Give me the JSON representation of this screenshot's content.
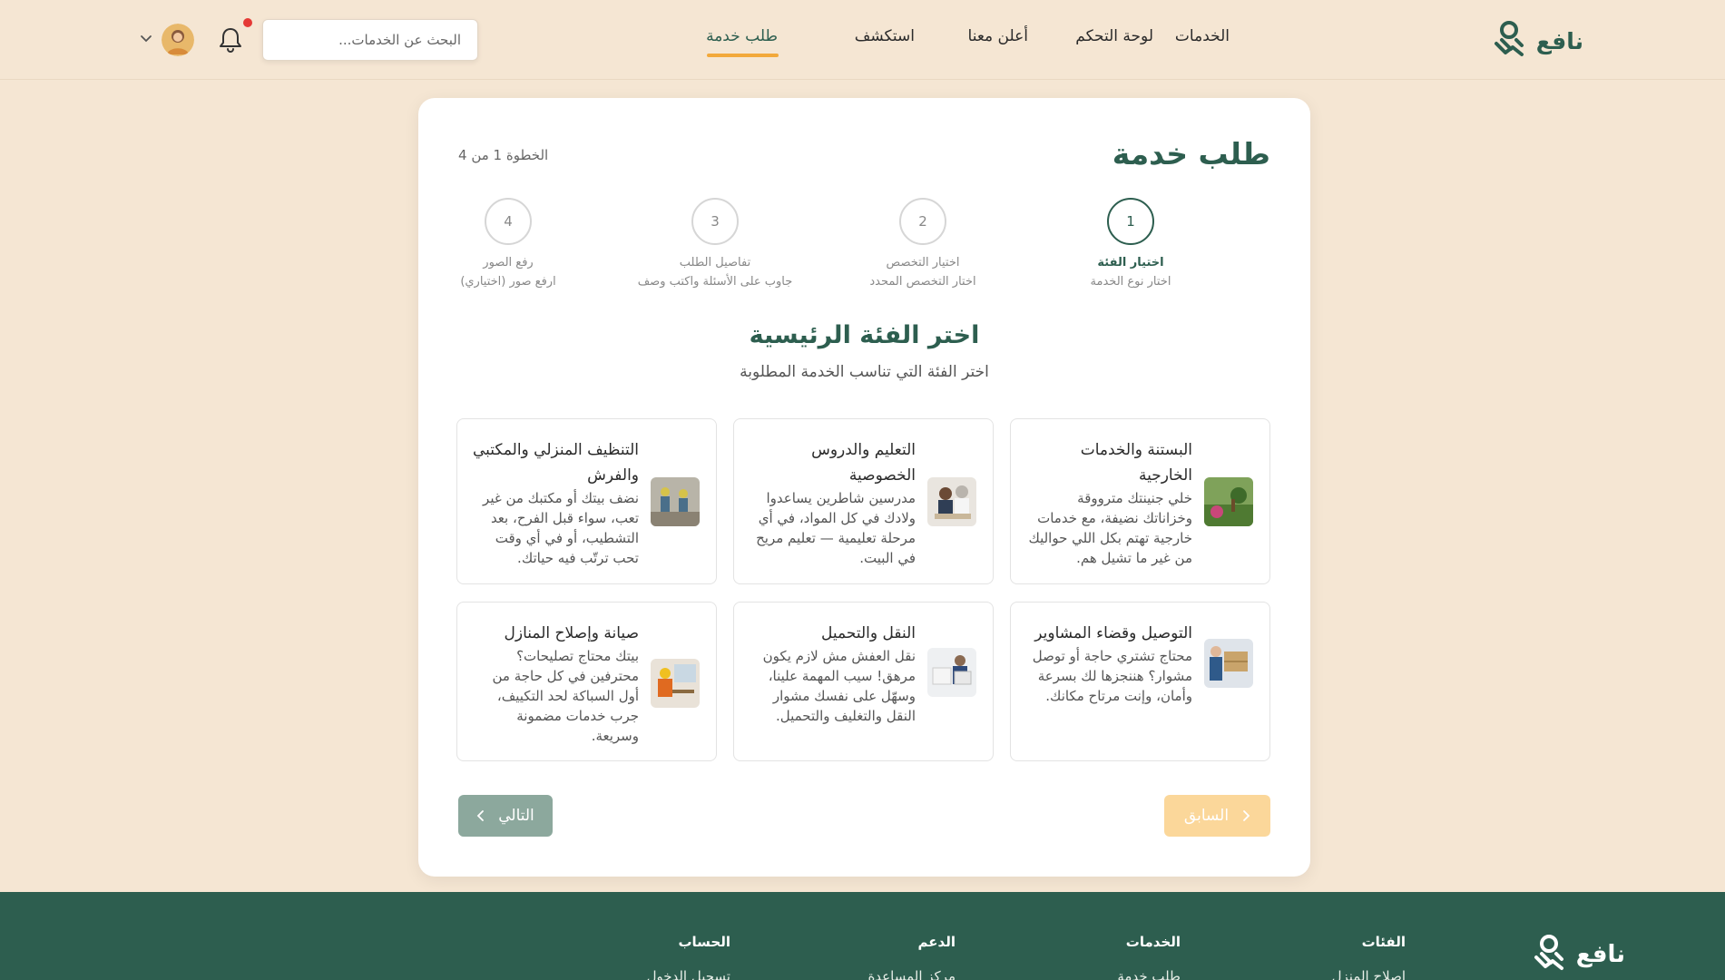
{
  "brand": {
    "name": "نافع",
    "color": "#2d5e4f",
    "accent": "#f2a93b"
  },
  "nav": [
    {
      "label": "الخدمات",
      "active": false
    },
    {
      "label": "لوحة التحكم",
      "active": false
    },
    {
      "label": "أعلن معنا",
      "active": false
    },
    {
      "label": "استكشف",
      "active": false
    },
    {
      "label": "طلب خدمة",
      "active": true
    }
  ],
  "search": {
    "placeholder": "البحث عن الخدمات..."
  },
  "page": {
    "title": "طلب خدمة",
    "step_counter": "الخطوة 1 من 4"
  },
  "steps": [
    {
      "number": "1",
      "title": "اختيار الفئة",
      "subtitle": "اختار نوع الخدمة",
      "active": true
    },
    {
      "number": "2",
      "title": "اختيار التخصص",
      "subtitle": "اختار التخصص المحدد",
      "active": false
    },
    {
      "number": "3",
      "title": "تفاصيل الطلب",
      "subtitle": "جاوب على الأسئلة واكتب وصف",
      "active": false
    },
    {
      "number": "4",
      "title": "رفع الصور",
      "subtitle": "ارفع صور (اختياري)",
      "active": false
    }
  ],
  "section": {
    "title": "اختر الفئة الرئيسية",
    "subtitle": "اختر الفئة التي تناسب الخدمة المطلوبة"
  },
  "categories": [
    {
      "title": "البستنة والخدمات الخارجية",
      "description": "خلي جنينتك مترووقة وخزاناتك نضيفة، مع خدمات خارجية تهتم بكل اللي حواليك من غير ما تشيل هم.",
      "icon": "garden-photo"
    },
    {
      "title": "التعليم والدروس الخصوصية",
      "description": "مدرسين شاطرين يساعدوا ولادك في كل المواد، في أي مرحلة تعليمية — تعليم مريح في البيت.",
      "icon": "tutoring-photo"
    },
    {
      "title": "التنظيف المنزلي والمكتبي والفرش",
      "description": "نضف بيتك أو مكتبك من غير تعب، سواء قبل الفرح، بعد التشطيب، أو في أي وقت تحب ترتّب فيه حياتك.",
      "icon": "cleaning-photo"
    },
    {
      "title": "التوصيل وقضاء المشاوير",
      "description": "محتاج تشتري حاجة أو توصل مشوار؟ هننجزها لك بسرعة وأمان، وإنت مرتاح مكانك.",
      "icon": "delivery-photo"
    },
    {
      "title": "النقل والتحميل",
      "description": "نقل العفش مش لازم يكون مرهق! سيب المهمة علينا، وسهّل على نفسك مشوار النقل والتغليف والتحميل.",
      "icon": "moving-photo"
    },
    {
      "title": "صيانة وإصلاح المنازل",
      "description": "بيتك محتاج تصليحات؟ محترفين في كل حاجة من أول السباكة لحد التكييف، جرب خدمات مضمونة وسريعة.",
      "icon": "repair-photo"
    }
  ],
  "buttons": {
    "next": "التالي",
    "previous": "السابق"
  },
  "footer": {
    "brand": "نافع",
    "columns": [
      {
        "heading": "الفئات",
        "first_link": "إصلاح المنزل"
      },
      {
        "heading": "الخدمات",
        "first_link": "طلب خدمة"
      },
      {
        "heading": "الدعم",
        "first_link": "مركز المساعدة"
      },
      {
        "heading": "الحساب",
        "first_link": "تسجيل الدخول"
      }
    ]
  }
}
